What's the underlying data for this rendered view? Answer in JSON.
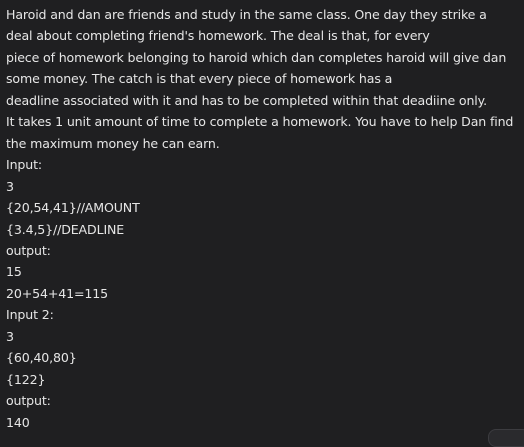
{
  "message": {
    "lines": [
      "Haroid and dan are friends and study in the same class. One day they strike a",
      "deal about completing friend's homework. The deal is that, for every",
      "piece of homework belonging to haroid which dan completes haroid will give dan",
      "some money. The catch is that every piece of homework has a",
      "deadline associated with it and has to be completed within that deadiine only.",
      "It takes 1 unit amount of time to complete a homework. You have to help Dan find",
      "the maximum money he can earn.",
      "Input:",
      "3",
      "{20,54,41}//AMOUNT",
      "{3.4,5}//DEADLINE",
      "output:",
      "15",
      "20+54+41=115",
      "Input 2:",
      "3",
      "{60,40,80}",
      "{122}",
      "output:",
      "140"
    ]
  },
  "colors": {
    "background": "#1f1f21",
    "text": "#e6e6e6"
  }
}
